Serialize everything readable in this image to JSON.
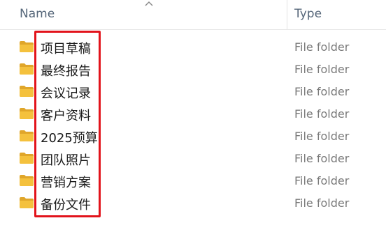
{
  "header": {
    "name_label": "Name",
    "type_label": "Type"
  },
  "files": [
    {
      "name": "项目草稿",
      "type": "File folder",
      "icon": "folder-icon"
    },
    {
      "name": "最终报告",
      "type": "File folder",
      "icon": "folder-icon"
    },
    {
      "name": "会议记录",
      "type": "File folder",
      "icon": "folder-icon"
    },
    {
      "name": "客户资料",
      "type": "File folder",
      "icon": "folder-icon"
    },
    {
      "name": "2025预算",
      "type": "File folder",
      "icon": "folder-icon"
    },
    {
      "name": "团队照片",
      "type": "File folder",
      "icon": "folder-icon"
    },
    {
      "name": "营销方案",
      "type": "File folder",
      "icon": "folder-icon"
    },
    {
      "name": "备份文件",
      "type": "File folder",
      "icon": "folder-icon"
    }
  ],
  "colors": {
    "folder": "#f4c13d",
    "folder_dark": "#e0a62a",
    "highlight": "#e2131b"
  }
}
